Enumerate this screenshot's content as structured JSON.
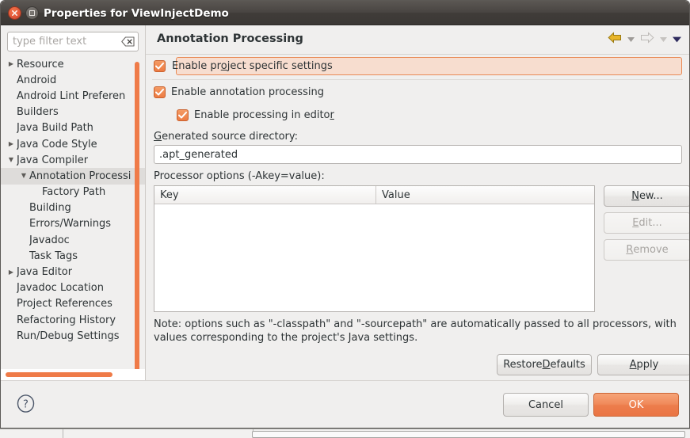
{
  "window": {
    "title": "Properties for ViewInjectDemo",
    "close_icon": "close-icon",
    "maximize_icon": "maximize-icon"
  },
  "sidebar": {
    "filter": {
      "value": "",
      "placeholder": "type filter text",
      "clear_icon": "clear-filter-icon"
    },
    "items": [
      {
        "label": "Resource",
        "indent": 0,
        "twisty": "collapsed",
        "selected": false
      },
      {
        "label": "Android",
        "indent": 0,
        "twisty": "none",
        "selected": false
      },
      {
        "label": "Android Lint Preferen",
        "indent": 0,
        "twisty": "none",
        "selected": false
      },
      {
        "label": "Builders",
        "indent": 0,
        "twisty": "none",
        "selected": false
      },
      {
        "label": "Java Build Path",
        "indent": 0,
        "twisty": "none",
        "selected": false
      },
      {
        "label": "Java Code Style",
        "indent": 0,
        "twisty": "collapsed",
        "selected": false
      },
      {
        "label": "Java Compiler",
        "indent": 0,
        "twisty": "expanded",
        "selected": false
      },
      {
        "label": "Annotation Processi",
        "indent": 1,
        "twisty": "expanded",
        "selected": true
      },
      {
        "label": "Factory Path",
        "indent": 2,
        "twisty": "none",
        "selected": false
      },
      {
        "label": "Building",
        "indent": 1,
        "twisty": "none",
        "selected": false
      },
      {
        "label": "Errors/Warnings",
        "indent": 1,
        "twisty": "none",
        "selected": false
      },
      {
        "label": "Javadoc",
        "indent": 1,
        "twisty": "none",
        "selected": false
      },
      {
        "label": "Task Tags",
        "indent": 1,
        "twisty": "none",
        "selected": false
      },
      {
        "label": "Java Editor",
        "indent": 0,
        "twisty": "collapsed",
        "selected": false
      },
      {
        "label": "Javadoc Location",
        "indent": 0,
        "twisty": "none",
        "selected": false
      },
      {
        "label": "Project References",
        "indent": 0,
        "twisty": "none",
        "selected": false
      },
      {
        "label": "Refactoring History",
        "indent": 0,
        "twisty": "none",
        "selected": false
      },
      {
        "label": "Run/Debug Settings",
        "indent": 0,
        "twisty": "none",
        "selected": false
      }
    ]
  },
  "page": {
    "title": "Annotation Processing",
    "nav": {
      "back_icon": "back-arrow-icon",
      "back_dropdown_icon": "chevron-down-icon",
      "forward_icon": "forward-arrow-icon",
      "forward_dropdown_icon": "chevron-down-icon",
      "menu_icon": "chevron-down-icon"
    },
    "project_specific": {
      "label_pre": "Enable pr",
      "label_mnemonic": "o",
      "label_post": "ject specific settings",
      "checked": true,
      "checkbox_icon": "checkbox-checked-icon"
    },
    "enable_annotation_processing": {
      "label": "Enable annotation processing",
      "checked": true,
      "checkbox_icon": "checkbox-checked-icon"
    },
    "enable_processing_in_editor": {
      "label_pre": "Enable processing in edito",
      "label_mnemonic": "r",
      "label_post": "",
      "checked": true,
      "checkbox_icon": "checkbox-checked-icon"
    },
    "generated_source": {
      "label_mnemonic": "G",
      "label_post": "enerated source directory:",
      "value": ".apt_generated",
      "placeholder": ""
    },
    "processor_options": {
      "label": "Processor options (-Akey=value):",
      "columns": [
        "Key",
        "Value"
      ],
      "rows": []
    },
    "buttons": {
      "new": {
        "pre": "",
        "mnemonic": "N",
        "post": "ew...",
        "enabled": true
      },
      "edit": {
        "pre": "",
        "mnemonic": "E",
        "post": "dit...",
        "enabled": false
      },
      "remove": {
        "pre": "",
        "mnemonic": "R",
        "post": "emove",
        "enabled": false
      },
      "restore": {
        "pre": "Restore ",
        "mnemonic": "D",
        "post": "efaults",
        "enabled": true
      },
      "apply": {
        "pre": "",
        "mnemonic": "A",
        "post": "pply",
        "enabled": true
      }
    },
    "note": "Note: options such as \"-classpath\" and \"-sourcepath\" are automatically passed to all processors, with values corresponding to the project's Java settings."
  },
  "footer": {
    "help_icon": "help-icon",
    "cancel_label": "Cancel",
    "ok_label": "OK"
  },
  "colors": {
    "accent_orange": "#ef7b48",
    "ok_button": "#ed7d4c",
    "focus_bg": "#f7ddcf",
    "focus_border": "#e98a55",
    "titlebar": "#494542",
    "panel_bg": "#f0efee",
    "selection_bg": "#dedcda",
    "nav_back_arrow": "#d8a520",
    "nav_menu_caret": "#2e2b5e"
  }
}
